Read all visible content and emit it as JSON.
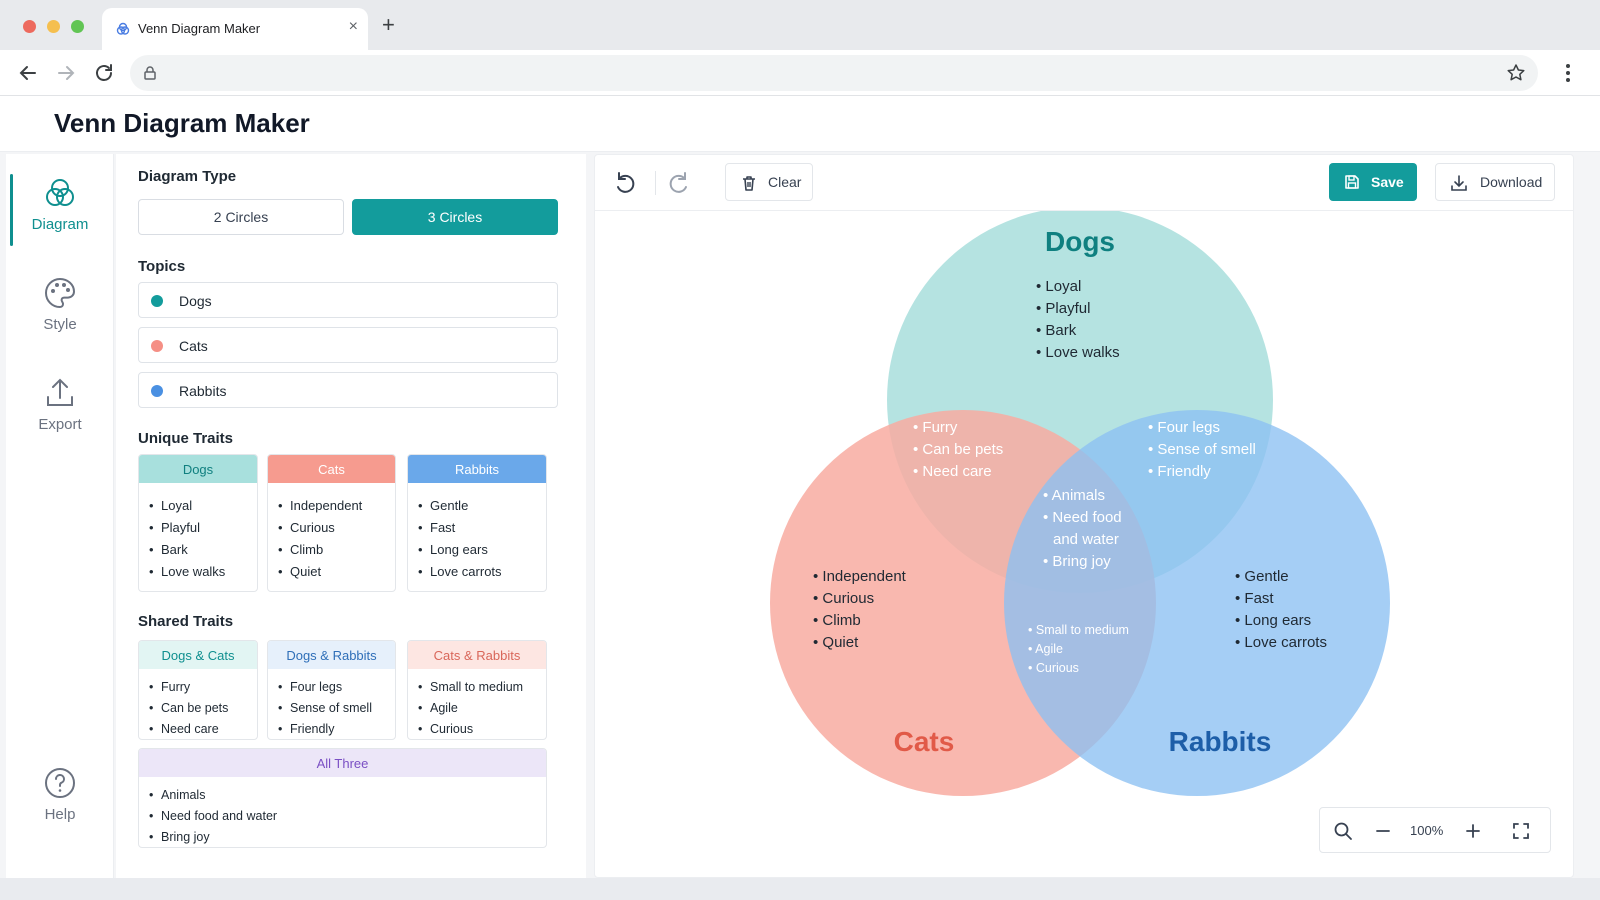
{
  "browser": {
    "tab_title": "Venn Diagram Maker",
    "tab_close": "×",
    "new_tab": "+"
  },
  "app": {
    "title": "Venn Diagram Maker"
  },
  "rail": {
    "items": [
      {
        "label": "Diagram",
        "icon": "venn-icon",
        "active": true
      },
      {
        "label": "Style",
        "icon": "palette-icon",
        "active": false
      },
      {
        "label": "Export",
        "icon": "upload-icon",
        "active": false
      },
      {
        "label": "Help",
        "icon": "help-icon",
        "active": false
      }
    ]
  },
  "panel": {
    "diagram_type_title": "Diagram Type",
    "diagram_types": [
      "2 Circles",
      "3 Circles"
    ],
    "selected_type": "3 Circles",
    "topics_title": "Topics",
    "topics": [
      {
        "name": "Dogs",
        "color": "#139c9c"
      },
      {
        "name": "Cats",
        "color": "#f58f85"
      },
      {
        "name": "Rabbits",
        "color": "#4a90e2"
      }
    ],
    "unique_title": "Unique Traits",
    "unique": [
      {
        "head": "Dogs",
        "items": [
          "Loyal",
          "Playful",
          "Bark",
          "Love walks"
        ]
      },
      {
        "head": "Cats",
        "items": [
          "Independent",
          "Curious",
          "Climb",
          "Quiet"
        ]
      },
      {
        "head": "Rabbits",
        "items": [
          "Gentle",
          "Fast",
          "Long ears",
          "Love carrots"
        ]
      }
    ],
    "shared_title": "Shared Traits",
    "shared": [
      {
        "head": "Dogs & Cats",
        "items": [
          "Furry",
          "Can be pets",
          "Need care"
        ]
      },
      {
        "head": "Dogs & Rabbits",
        "items": [
          "Four legs",
          "Sense of smell",
          "Friendly"
        ]
      },
      {
        "head": "Cats & Rabbits",
        "items": [
          "Small to medium",
          "Agile",
          "Curious"
        ]
      }
    ],
    "all_three": {
      "head": "All Three",
      "items": [
        "Animals",
        "Need food and water",
        "Bring joy"
      ]
    }
  },
  "canvas": {
    "clear_label": "Clear",
    "save_label": "Save",
    "download_label": "Download",
    "zoom": "100%"
  },
  "venn": {
    "labels": {
      "dogs": "Dogs",
      "cats": "Cats",
      "rabbits": "Rabbits"
    },
    "dogs_only": [
      "Loyal",
      "Playful",
      "Bark",
      "Love walks"
    ],
    "cats_only": [
      "Independent",
      "Curious",
      "Climb",
      "Quiet"
    ],
    "rabbits_only": [
      "Gentle",
      "Fast",
      "Long ears",
      "Love carrots"
    ],
    "dogs_cats": [
      "Furry",
      "Can be pets",
      "Need care"
    ],
    "dogs_rabbits": [
      "Four legs",
      "Sense of smell",
      "Friendly"
    ],
    "cats_rabbits": [
      "Small to medium",
      "Agile",
      "Curious"
    ],
    "center_lines": [
      "Animals",
      "Need food",
      "and water",
      "Bring joy"
    ],
    "colors": {
      "dogs": "#a8dedc",
      "cats": "#f8aca1",
      "rabbits": "#a3cdf5"
    }
  }
}
